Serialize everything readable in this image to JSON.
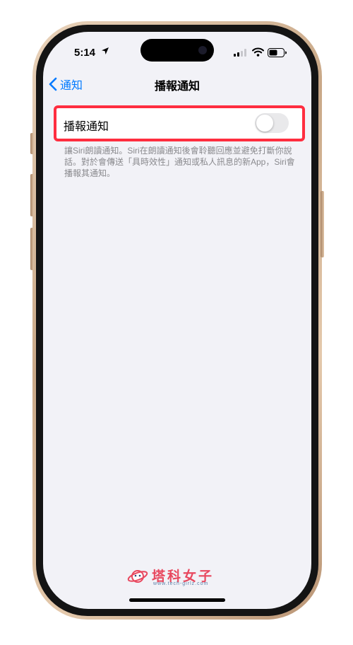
{
  "status_bar": {
    "time": "5:14"
  },
  "nav": {
    "back_label": "通知",
    "title": "播報通知"
  },
  "setting": {
    "label": "播報通知",
    "toggle_on": false
  },
  "footnote": "讓Siri朗讀通知。Siri在朗讀通知後會聆聽回應並避免打斷你說話。對於會傳送「具時效性」通知或私人訊息的新App，Siri會播報其通知。",
  "watermark": {
    "brand": "塔科女子",
    "url": "www.tech-girlz.com"
  },
  "colors": {
    "accent": "#007aff",
    "highlight": "#ff2d3f",
    "background": "#f2f2f7",
    "watermark": "#e8485f"
  },
  "icons": [
    "location-arrow-icon",
    "signal-icon",
    "wifi-icon",
    "battery-icon",
    "chevron-left-icon"
  ]
}
